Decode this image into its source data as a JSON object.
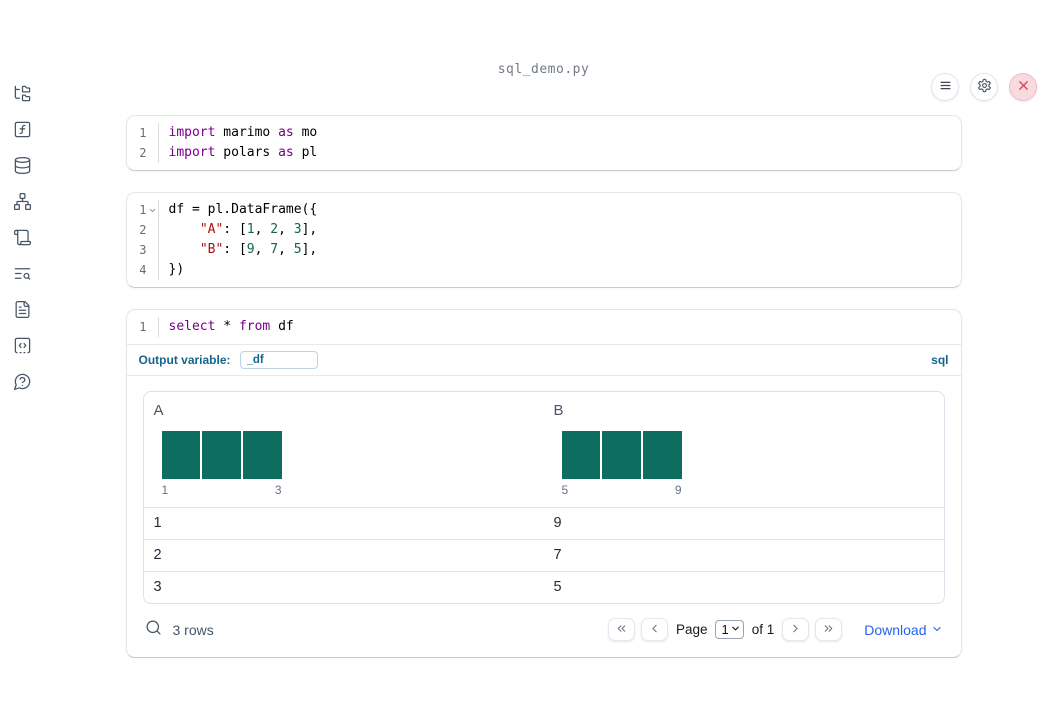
{
  "window": {
    "title": "sql_demo.py"
  },
  "toolbar": {
    "buttons": [
      {
        "name": "menu-button",
        "icon": "menu-icon"
      },
      {
        "name": "settings-button",
        "icon": "gear-icon"
      },
      {
        "name": "close-button",
        "icon": "close-icon"
      }
    ]
  },
  "sidebar": {
    "items": [
      {
        "name": "file-explorer",
        "icon": "folder-tree-icon"
      },
      {
        "name": "variables",
        "icon": "function-square-icon"
      },
      {
        "name": "data-sources",
        "icon": "database-icon"
      },
      {
        "name": "dependency-graph",
        "icon": "network-icon"
      },
      {
        "name": "logs",
        "icon": "scroll-icon"
      },
      {
        "name": "documentation",
        "icon": "text-search-icon"
      },
      {
        "name": "scratchpad",
        "icon": "file-text-icon"
      },
      {
        "name": "snippets",
        "icon": "code-square-icon"
      },
      {
        "name": "help",
        "icon": "help-bubble-icon"
      }
    ]
  },
  "cells": [
    {
      "name": "imports-cell",
      "lines": [
        {
          "n": "1",
          "tokens": [
            [
              "import",
              "kw"
            ],
            [
              " marimo ",
              "pl"
            ],
            [
              "as",
              "kw"
            ],
            [
              " mo",
              "pl"
            ]
          ]
        },
        {
          "n": "2",
          "tokens": [
            [
              "import",
              "kw"
            ],
            [
              " polars ",
              "pl"
            ],
            [
              "as",
              "kw"
            ],
            [
              " pl",
              "pl"
            ]
          ]
        }
      ]
    },
    {
      "name": "dataframe-cell",
      "lines": [
        {
          "n": "1",
          "fold": true,
          "tokens": [
            [
              "df = pl.DataFrame({",
              "pl"
            ]
          ]
        },
        {
          "n": "2",
          "tokens": [
            [
              "    ",
              "pl"
            ],
            [
              "\"A\"",
              "str"
            ],
            [
              ": [",
              "pl"
            ],
            [
              "1",
              "num"
            ],
            [
              ", ",
              "pl"
            ],
            [
              "2",
              "num"
            ],
            [
              ", ",
              "pl"
            ],
            [
              "3",
              "num"
            ],
            [
              "],",
              "pl"
            ]
          ]
        },
        {
          "n": "3",
          "tokens": [
            [
              "    ",
              "pl"
            ],
            [
              "\"B\"",
              "str"
            ],
            [
              ": [",
              "pl"
            ],
            [
              "9",
              "num"
            ],
            [
              ", ",
              "pl"
            ],
            [
              "7",
              "num"
            ],
            [
              ", ",
              "pl"
            ],
            [
              "5",
              "num"
            ],
            [
              "],",
              "pl"
            ]
          ]
        },
        {
          "n": "4",
          "tokens": [
            [
              "})",
              "pl"
            ]
          ]
        }
      ]
    },
    {
      "name": "sql-cell",
      "lines": [
        {
          "n": "1",
          "tokens": [
            [
              "select",
              "kw"
            ],
            [
              " * ",
              "pl"
            ],
            [
              "from",
              "kw"
            ],
            [
              " df",
              "pl"
            ]
          ]
        }
      ]
    }
  ],
  "sql_cell": {
    "output_variable_label": "Output variable:",
    "output_variable_value": "_df",
    "language_badge": "sql"
  },
  "table": {
    "columns": [
      {
        "header": "A",
        "hist_min": "1",
        "hist_max": "3",
        "bars": [
          1,
          1,
          1
        ]
      },
      {
        "header": "B",
        "hist_min": "5",
        "hist_max": "9",
        "bars": [
          1,
          1,
          1
        ]
      }
    ],
    "rows": [
      [
        "1",
        "9"
      ],
      [
        "2",
        "7"
      ],
      [
        "3",
        "5"
      ]
    ],
    "row_count_label": "3 rows",
    "pagination": {
      "page_label": "Page",
      "page_value": "1",
      "of_label": "of 1"
    },
    "download_label": "Download"
  },
  "colors": {
    "accent_blue": "#15658d",
    "link_blue": "#2563eb",
    "histogram_teal": "#0d6e5f",
    "syntax_keyword": "#770088",
    "syntax_string": "#aa1111",
    "syntax_number": "#116644",
    "icon_slate": "#475569",
    "close_red": "#c84a4f"
  }
}
